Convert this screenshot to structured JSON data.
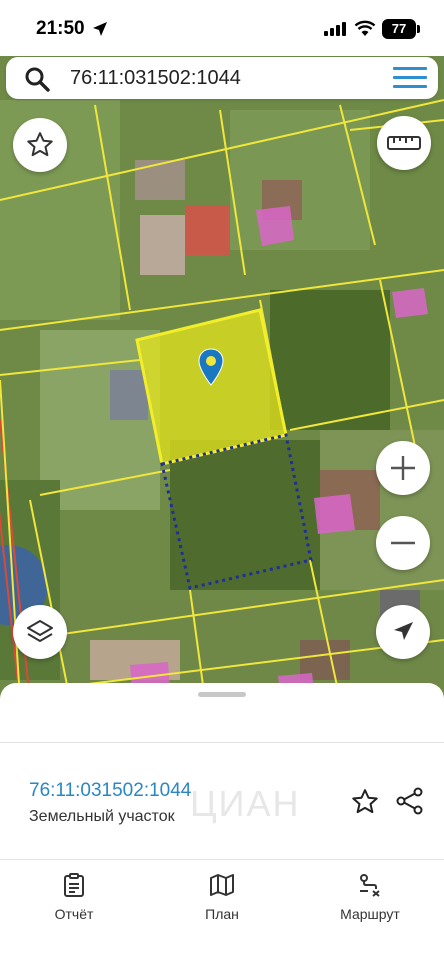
{
  "status": {
    "time": "21:50",
    "battery": "77"
  },
  "search": {
    "query": "76:11:031502:1044"
  },
  "parcel": {
    "cadastral_number": "76:11:031502:1044",
    "type": "Земельный участок"
  },
  "tabs": [
    {
      "label": "Отчёт",
      "icon": "report-icon"
    },
    {
      "label": "План",
      "icon": "map-plan-icon"
    },
    {
      "label": "Маршрут",
      "icon": "route-icon"
    }
  ],
  "watermark": "ЦИАН",
  "colors": {
    "accent": "#2a86c6",
    "parcel_fill": "#e6e61e",
    "boundary": "#f0e63c",
    "pin": "#1a78c2",
    "building_pink": "#d966c9"
  }
}
